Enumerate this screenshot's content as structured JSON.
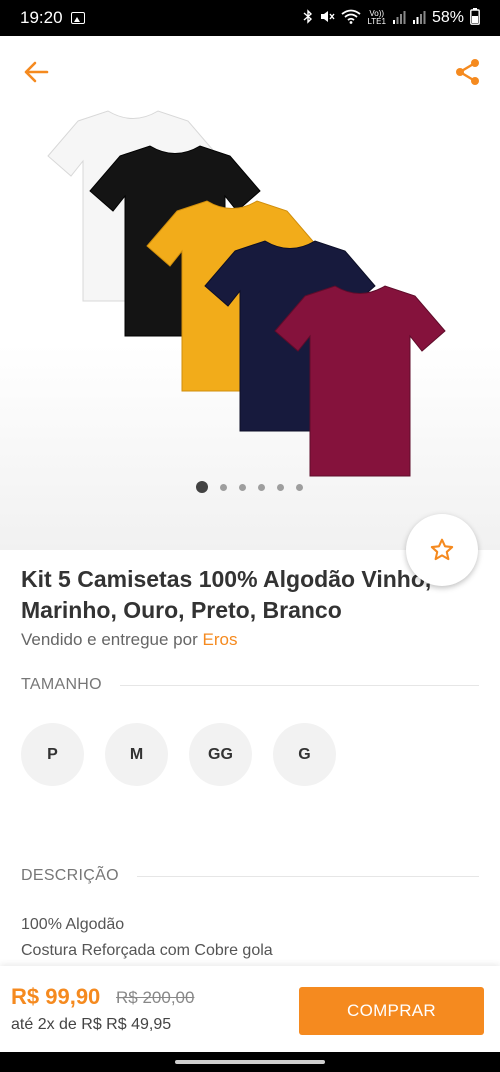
{
  "status_bar": {
    "time": "19:20",
    "battery": "58%",
    "icons": [
      "gallery-icon",
      "bluetooth-icon",
      "mute-icon",
      "wifi-icon",
      "volte-icon",
      "signal-icon",
      "signal-icon"
    ],
    "volte_label_top": "Vo))",
    "volte_label_bottom": "LTE1"
  },
  "header": {
    "back_icon": "arrow-left-icon",
    "share_icon": "share-icon",
    "accent_color": "#f58a1f"
  },
  "gallery": {
    "image": "t-shirts-kit",
    "dot_count": 6,
    "active_dot": 0,
    "shirt_colors": [
      "#f6f6f6",
      "#141414",
      "#f2ac1a",
      "#171a3d",
      "#85123c"
    ]
  },
  "favorite": {
    "icon": "star-outline-icon"
  },
  "product": {
    "title_line1": "Kit 5 Camisetas 100% Algodão Vinho,",
    "title_line2": "Marinho, Ouro, Preto, Branco",
    "sold_by_prefix": "Vendido e entregue por ",
    "seller": "Eros"
  },
  "size_section": {
    "label": "TAMANHO",
    "options": [
      "P",
      "M",
      "GG",
      "G"
    ]
  },
  "description_section": {
    "label": "DESCRIÇÃO",
    "lines": [
      "100% Algodão",
      "Costura Reforçada com Cobre gola"
    ]
  },
  "purchase": {
    "price": "R$ 99,90",
    "old_price": "R$ 200,00",
    "installment": "até 2x de R$ R$ 49,95",
    "buy_label": "COMPRAR"
  }
}
